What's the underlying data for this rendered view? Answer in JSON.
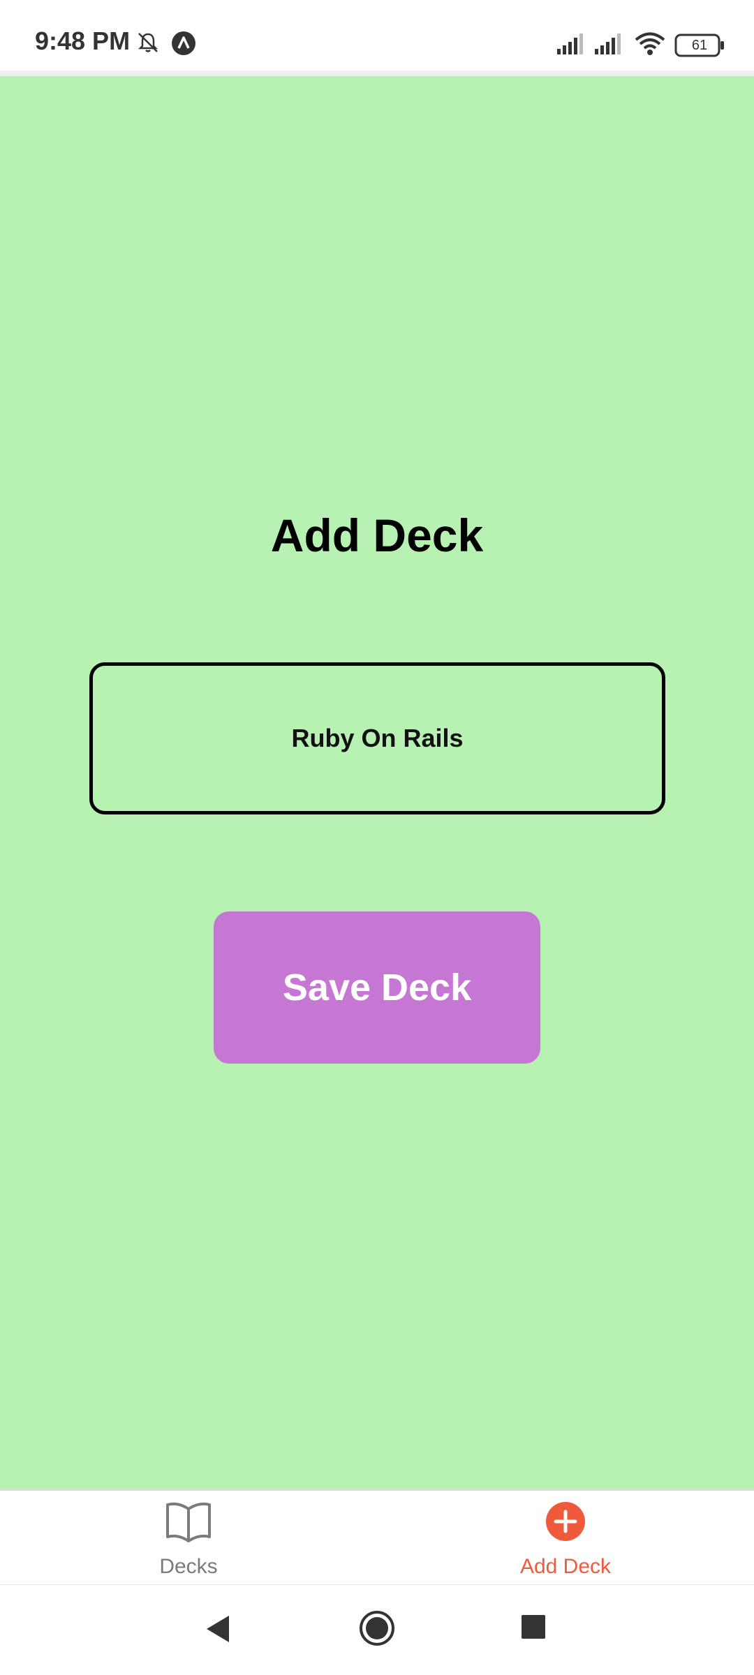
{
  "status_bar": {
    "time": "9:48 PM",
    "battery": "61",
    "icons": [
      "mute-bell-icon",
      "app-notification-icon",
      "signal-icon",
      "signal-icon",
      "wifi-icon",
      "battery-icon"
    ]
  },
  "page": {
    "title": "Add Deck",
    "background_color": "#b7f2b3"
  },
  "form": {
    "deck_name_value": "Ruby On Rails",
    "save_label": "Save Deck",
    "save_color": "#c677d3"
  },
  "tabs": [
    {
      "label": "Decks",
      "icon": "book-icon",
      "active": false
    },
    {
      "label": "Add Deck",
      "icon": "plus-circle-icon",
      "active": true,
      "active_color": "#f05a3c"
    }
  ],
  "system_nav": {
    "icons": [
      "back-icon",
      "home-icon",
      "recents-icon"
    ]
  }
}
